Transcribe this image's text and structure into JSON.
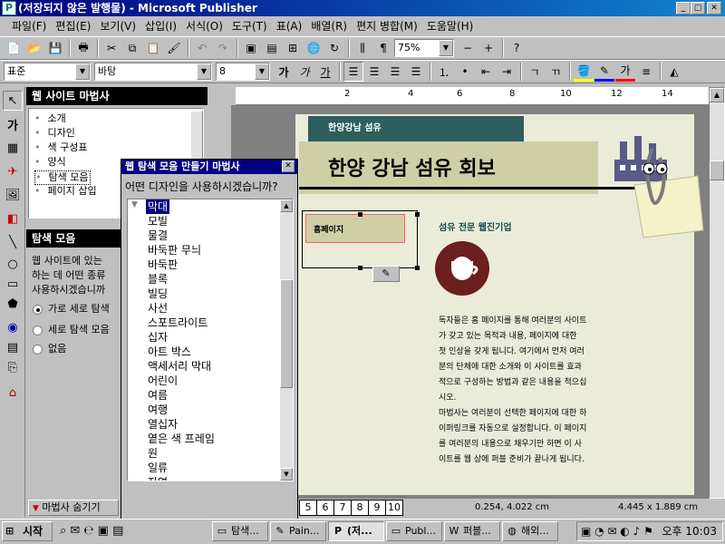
{
  "window": {
    "title": "(저장되지 않은 발행물) - Microsoft Publisher",
    "icon": "publisher-icon"
  },
  "menu": [
    "파일(F)",
    "편집(E)",
    "보기(V)",
    "삽입(I)",
    "서식(O)",
    "도구(T)",
    "표(A)",
    "배열(R)",
    "편지 병합(M)",
    "도움말(H)"
  ],
  "toolbar": {
    "zoom": "75%"
  },
  "format_bar": {
    "style": "표준",
    "font": "바탕",
    "size": "8"
  },
  "wizard": {
    "header": "웹 사이트 마법사",
    "steps": [
      "소개",
      "디자인",
      "색 구성표",
      "양식",
      "탐색 모음",
      "페이지 삽입"
    ],
    "section_header": "탐색 모음",
    "question_lines": [
      "웹 사이트에 있는",
      "하는 데 어떤 종류",
      "사용하시겠습니까"
    ],
    "options": [
      "가로 세로 탐색",
      "세로 탐색 모음",
      "없음"
    ],
    "hide_label": "마법사 숨기기"
  },
  "dialog": {
    "title": "웹 탐색 모음 만들기 마법사",
    "question": "어떤 디자인을 사용하시겠습니까?",
    "items": [
      "막대",
      "모빌",
      "물결",
      "바둑판 무늬",
      "바둑판",
      "블록",
      "빌딩",
      "사선",
      "스포트라이트",
      "십자",
      "아트 박스",
      "액세서리 막대",
      "어린이",
      "여름",
      "여행",
      "열십자",
      "옅은 색 프레임",
      "원",
      "일류",
      "자연"
    ]
  },
  "page": {
    "brand": "한양강남 섬유",
    "title": "한양 강남 섬유 회보",
    "nav_label": "홈페이지",
    "company_line": "섬유 전문 웹진기업",
    "paragraph1": [
      "독자들은 홈 페이지를 통해 여러분의 사이트",
      "가 갖고 있는 목적과 내용, 페이지에 대한",
      "첫 인상을 갖게 됩니다. 여기에서 먼저 여러",
      "분의 단체에 대한 소개와 이 사이트를 효과",
      "적으로 구성하는 방법과 같은 내용을 적으십",
      "시오."
    ],
    "paragraph2": [
      "마법사는 여러분이 선택한 페이지에 대한 하",
      "이퍼링크를 자동으로 설정합니다. 이 페이지",
      "를 여러분의 내용으로 채우기만 하면 이 사",
      "이트를 웹 상에 퍼블 준비가 끝나게 됩니다."
    ]
  },
  "page_tabs": [
    "5",
    "6",
    "7",
    "8",
    "9",
    "10"
  ],
  "status": {
    "position": "0.254, 4.022 cm",
    "size": "4.445 x 1.889 cm"
  },
  "taskbar": {
    "start": "시작",
    "tasks": [
      "탐색...",
      "Pain...",
      "(저...",
      "Publ...",
      "퍼블...",
      "해외..."
    ],
    "clock": "오후 10:03"
  },
  "ruler_numbers": [
    "2",
    "4",
    "6",
    "8",
    "10",
    "12",
    "14"
  ]
}
